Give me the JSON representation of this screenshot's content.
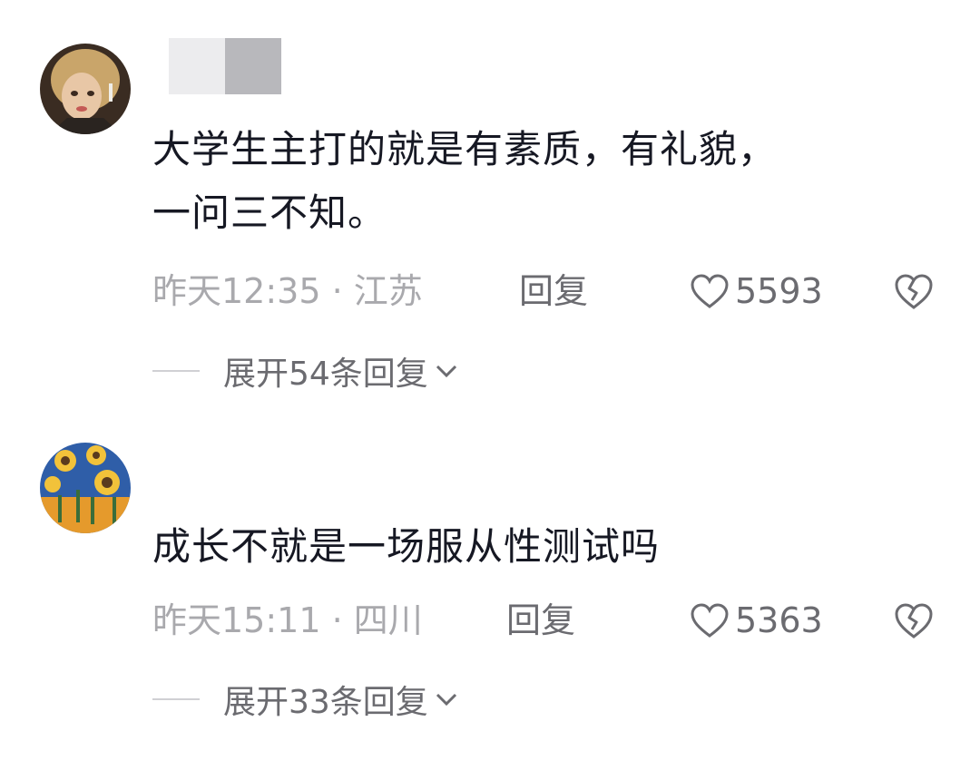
{
  "comments": [
    {
      "text_line1": "大学生主打的就是有素质，有礼貌，",
      "text_line2": "一问三不知。",
      "time_location": "昨天12:35 · 江苏",
      "reply_label": "回复",
      "likes": "5593",
      "expand_label": "展开54条回复"
    },
    {
      "text_line1": "成长不就是一场服从性测试吗",
      "time_location": "昨天15:11 · 四川",
      "reply_label": "回复",
      "likes": "5363",
      "expand_label": "展开33条回复"
    }
  ],
  "colors": {
    "text_primary": "#161823",
    "text_secondary": "#a9a9ad",
    "text_action": "#6b6b70"
  },
  "icons": [
    "heart-outline-icon",
    "broken-heart-icon",
    "chevron-down-icon"
  ]
}
